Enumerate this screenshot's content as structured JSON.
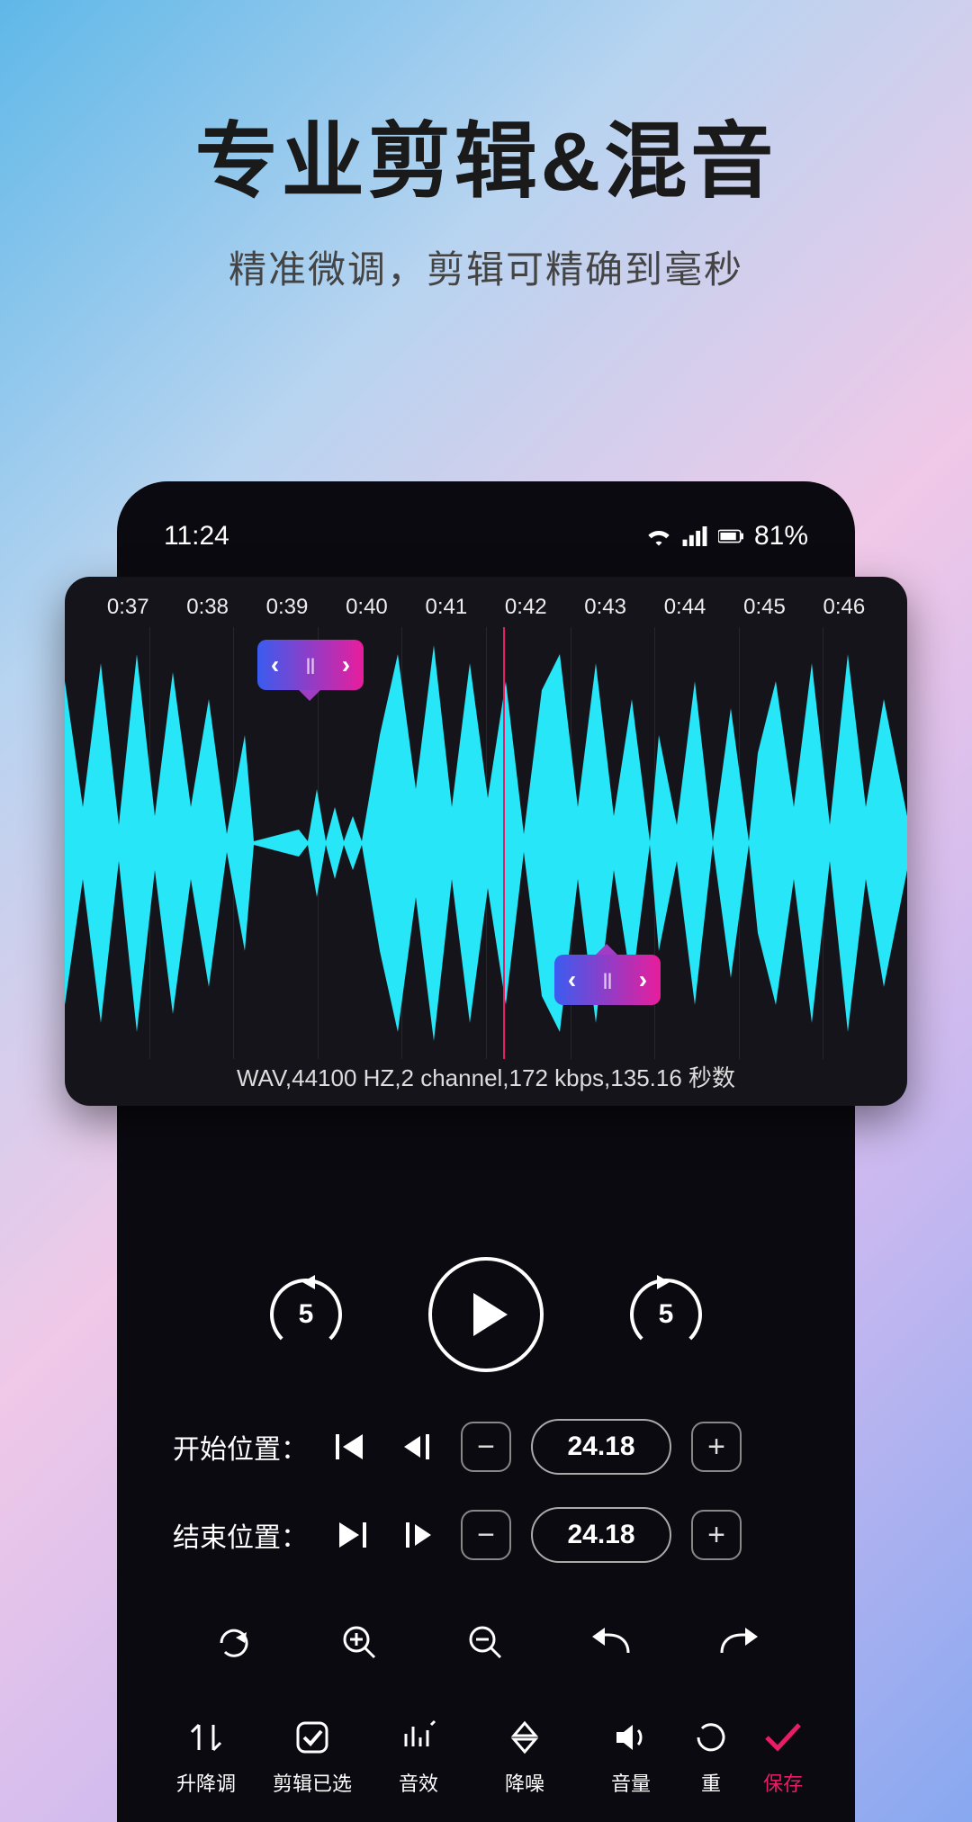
{
  "hero": {
    "title": "专业剪辑&混音",
    "subtitle": "精准微调，剪辑可精确到毫秒"
  },
  "status": {
    "time": "11:24",
    "battery": "81%"
  },
  "timeline": {
    "ticks": [
      "0:37",
      "0:38",
      "0:39",
      "0:40",
      "0:41",
      "0:42",
      "0:43",
      "0:44",
      "0:45",
      "0:46"
    ],
    "playhead_pct": 52
  },
  "audio_info": "WAV,44100 HZ,2 channel,172 kbps,135.16 秒数",
  "transport": {
    "rewind_seconds": "5",
    "forward_seconds": "5"
  },
  "positions": {
    "start_label": "开始位置：",
    "start_value": "24.18",
    "end_label": "结束位置：",
    "end_value": "24.18"
  },
  "tabs": [
    {
      "id": "pitch",
      "label": "升降调"
    },
    {
      "id": "cut",
      "label": "剪辑已选"
    },
    {
      "id": "fx",
      "label": "音效"
    },
    {
      "id": "denoise",
      "label": "降噪"
    },
    {
      "id": "volume",
      "label": "音量"
    },
    {
      "id": "reset",
      "label": "重"
    },
    {
      "id": "save",
      "label": "保存"
    }
  ],
  "colors": {
    "accent": "#e81d6a",
    "wave": "#26e6f7"
  }
}
